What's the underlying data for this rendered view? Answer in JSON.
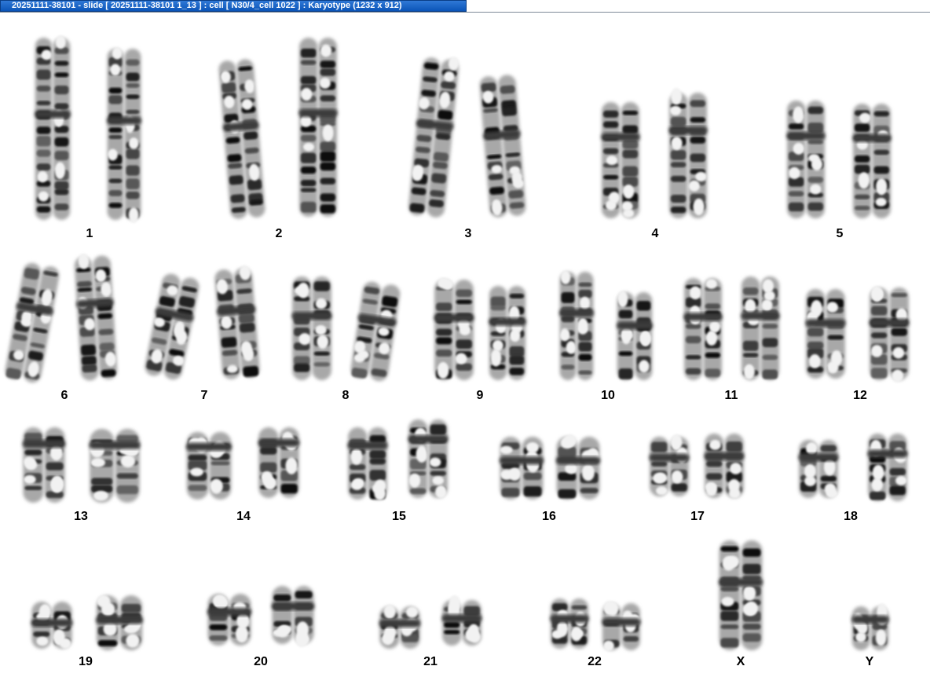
{
  "window": {
    "title": "20251111-38101 - slide [ 20251111-38101   1_13 ] : cell [ N30/4_cell 1022 ] : Karyotype  (1232 x 912)"
  },
  "karyotype": {
    "labels": [
      "1",
      "2",
      "3",
      "4",
      "5",
      "6",
      "7",
      "8",
      "9",
      "10",
      "11",
      "12",
      "13",
      "14",
      "15",
      "16",
      "17",
      "18",
      "19",
      "20",
      "21",
      "22",
      "X",
      "Y"
    ]
  }
}
